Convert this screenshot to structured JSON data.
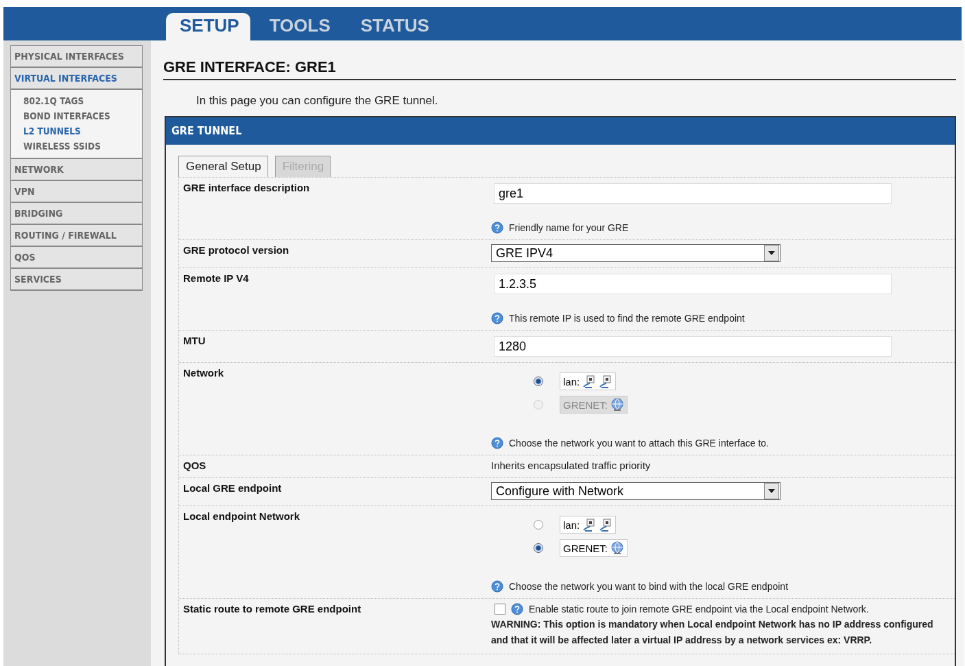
{
  "top_tabs": [
    {
      "label": "SETUP",
      "selected": true
    },
    {
      "label": "TOOLS",
      "selected": false
    },
    {
      "label": "STATUS",
      "selected": false
    }
  ],
  "sidebar": {
    "items": [
      {
        "label": "PHYSICAL INTERFACES",
        "selected": false
      },
      {
        "label": "VIRTUAL INTERFACES",
        "selected": true,
        "children": [
          {
            "label": "802.1Q TAGS",
            "selected": false
          },
          {
            "label": "BOND INTERFACES",
            "selected": false
          },
          {
            "label": "L2 TUNNELS",
            "selected": true
          },
          {
            "label": "WIRELESS SSIDS",
            "selected": false
          }
        ]
      },
      {
        "label": "NETWORK",
        "selected": false
      },
      {
        "label": "VPN",
        "selected": false
      },
      {
        "label": "BRIDGING",
        "selected": false
      },
      {
        "label": "ROUTING / FIREWALL",
        "selected": false
      },
      {
        "label": "QOS",
        "selected": false
      },
      {
        "label": "SERVICES",
        "selected": false
      }
    ]
  },
  "page": {
    "title": "GRE INTERFACE: GRE1",
    "intro": "In this page you can configure the GRE tunnel."
  },
  "panel": {
    "title": "GRE TUNNEL",
    "tabs": [
      {
        "label": "General Setup",
        "selected": true
      },
      {
        "label": "Filtering",
        "selected": false
      }
    ],
    "rows": [
      {
        "kind": "text",
        "label": "GRE interface description",
        "value": "gre1",
        "hint": "Friendly name for your GRE"
      },
      {
        "kind": "select",
        "label": "GRE protocol version",
        "value": "GRE IPV4"
      },
      {
        "kind": "text",
        "label": "Remote IP V4",
        "value": "1.2.3.5",
        "hint": "This remote IP is used to find the remote GRE endpoint"
      },
      {
        "kind": "text",
        "label": "MTU",
        "value": "1280"
      },
      {
        "kind": "radio",
        "label": "Network",
        "options": [
          {
            "kind": "lan",
            "label": "lan:",
            "selected": true,
            "disabled": false
          },
          {
            "kind": "tunnel",
            "label": "GRENET:",
            "selected": false,
            "disabled": true
          }
        ],
        "hint": "Choose the network you want to attach this GRE interface to."
      },
      {
        "kind": "static",
        "label": "QOS",
        "text": "Inherits encapsulated traffic priority"
      },
      {
        "kind": "select",
        "label": "Local GRE endpoint",
        "value": "Configure with Network"
      },
      {
        "kind": "radio",
        "label": "Local endpoint Network",
        "options": [
          {
            "kind": "lan",
            "label": "lan:",
            "selected": false,
            "disabled": false
          },
          {
            "kind": "tunnel",
            "label": "GRENET:",
            "selected": true,
            "disabled": false
          }
        ],
        "hint": "Choose the network you want to bind with the local GRE endpoint"
      },
      {
        "kind": "checkbox",
        "label": "Static route to remote GRE endpoint",
        "checked": false,
        "text": "Enable static route to join remote GRE endpoint via the Local endpoint Network.",
        "warning": "WARNING: This option is mandatory when Local endpoint Network has no IP address configured and that it will be affected later a virtual IP address by a network services ex: VRRP."
      }
    ]
  }
}
